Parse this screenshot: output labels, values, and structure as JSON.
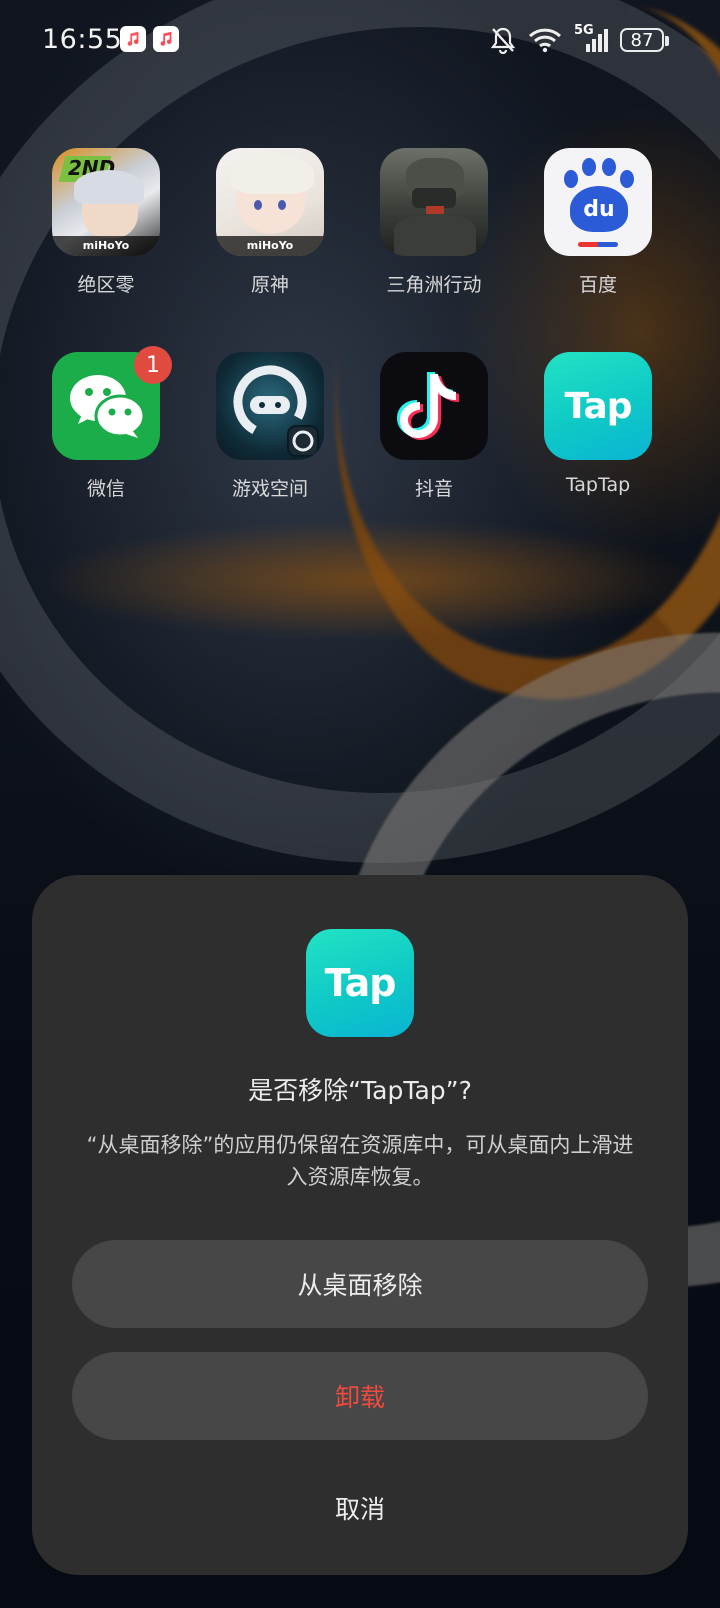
{
  "status_bar": {
    "time": "16:55",
    "battery": "87",
    "network": "5G",
    "icons": [
      "music-icon",
      "music-icon",
      "bell-muted-icon",
      "wifi-icon",
      "signal-icon",
      "battery-icon"
    ]
  },
  "apps": [
    {
      "label": "绝区零",
      "icon": "zenless-zone-zero-icon",
      "icon_text": "2ND",
      "brand": "miHoYo"
    },
    {
      "label": "原神",
      "icon": "genshin-impact-icon",
      "brand": "miHoYo"
    },
    {
      "label": "三角洲行动",
      "icon": "delta-force-icon"
    },
    {
      "label": "百度",
      "icon": "baidu-icon",
      "icon_text": "du"
    },
    {
      "label": "微信",
      "icon": "wechat-icon",
      "badge": "1"
    },
    {
      "label": "游戏空间",
      "icon": "game-space-icon"
    },
    {
      "label": "抖音",
      "icon": "douyin-icon"
    },
    {
      "label": "TapTap",
      "icon": "taptap-icon",
      "icon_text": "Tap"
    }
  ],
  "dialog": {
    "icon_text": "Tap",
    "title": "是否移除“TapTap”?",
    "message": "“从桌面移除”的应用仍保留在资源库中，可从桌面内上滑进入资源库恢复。",
    "buttons": {
      "remove": "从桌面移除",
      "uninstall": "卸载",
      "cancel": "取消"
    }
  },
  "colors": {
    "dialog_bg": "#2e2e2e",
    "button_bg": "#474747",
    "uninstall": "#ef4a3e",
    "badge": "#e04a3f",
    "taptap": "#0fc9c6",
    "wechat": "#1aad4a"
  }
}
